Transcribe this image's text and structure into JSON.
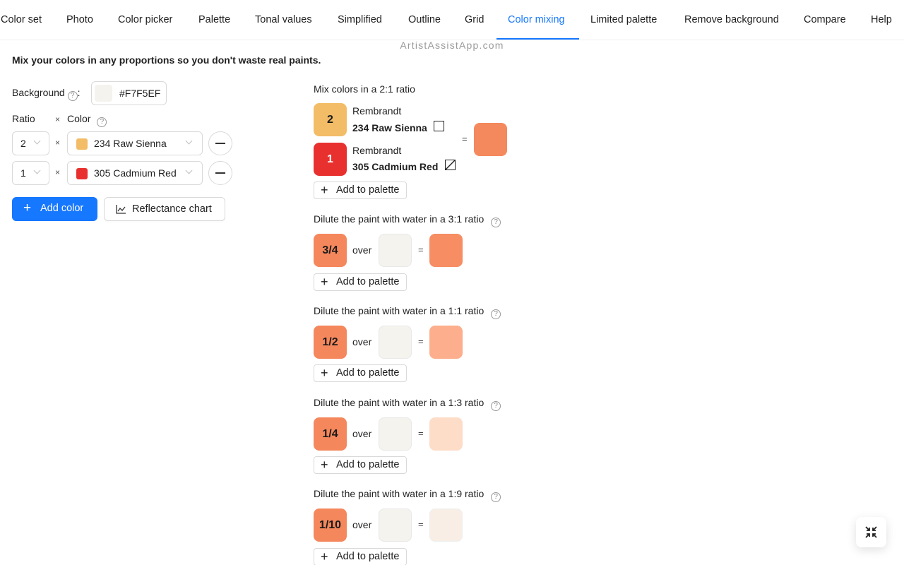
{
  "tabs": [
    {
      "label": "Color set",
      "active": false
    },
    {
      "label": "Photo",
      "active": false
    },
    {
      "label": "Color picker",
      "active": false
    },
    {
      "label": "Palette",
      "active": false
    },
    {
      "label": "Tonal values",
      "active": false
    },
    {
      "label": "Simplified",
      "active": false
    },
    {
      "label": "Outline",
      "active": false
    },
    {
      "label": "Grid",
      "active": false
    },
    {
      "label": "Color mixing",
      "active": true
    },
    {
      "label": "Limited palette",
      "active": false
    },
    {
      "label": "Remove background",
      "active": false
    },
    {
      "label": "Compare",
      "active": false
    },
    {
      "label": "Help",
      "active": false
    }
  ],
  "brand": "ArtistAssistApp.com",
  "intro": "Mix your colors in any proportions so you don't waste real paints.",
  "form": {
    "background_label": "Background",
    "background_colon": ":",
    "background_value": "#F7F5EF",
    "background_color": "#F4F3EE",
    "ratio_label": "Ratio",
    "times": "×",
    "color_label": "Color",
    "help_glyph": "?",
    "rows": [
      {
        "ratio": "2",
        "color_name": "234 Raw Sienna",
        "swatch": "#F2BD66"
      },
      {
        "ratio": "1",
        "color_name": "305 Cadmium Red",
        "swatch": "#E8312F"
      }
    ],
    "add_color_label": "Add color",
    "reflectance_label": "Reflectance chart"
  },
  "mix": {
    "title": "Mix colors in a 2:1 ratio",
    "equals": "=",
    "result_color": "#F5895E",
    "paints": [
      {
        "ratio": "2",
        "brand": "Rembrandt",
        "name": "234 Raw Sienna",
        "chip_color": "#F2BD66",
        "text_color": "#1a1a1a",
        "opacity_icon": "opaque-square-icon"
      },
      {
        "ratio": "1",
        "brand": "Rembrandt",
        "name": "305 Cadmium Red",
        "chip_color": "#E8312F",
        "text_color": "#ffffff",
        "opacity_icon": "semi-opaque-square-icon"
      }
    ],
    "add_to_palette": "Add to palette"
  },
  "dilutions": [
    {
      "title": "Dilute the paint with water in a 3:1 ratio",
      "fraction": "3/4",
      "over": "over",
      "paint_color": "#F5875C",
      "paper_color": "#F4F3EE",
      "result_color": "#F68D63",
      "add_to_palette": "Add to palette"
    },
    {
      "title": "Dilute the paint with water in a 1:1 ratio",
      "fraction": "1/2",
      "over": "over",
      "paint_color": "#F5875C",
      "paper_color": "#F4F3EE",
      "result_color": "#FDAE8C",
      "add_to_palette": "Add to palette"
    },
    {
      "title": "Dilute the paint with water in a 1:3 ratio",
      "fraction": "1/4",
      "over": "over",
      "paint_color": "#F5875C",
      "paper_color": "#F4F3EE",
      "result_color": "#FDDCC8",
      "add_to_palette": "Add to palette"
    },
    {
      "title": "Dilute the paint with water in a 1:9 ratio",
      "fraction": "1/10",
      "over": "over",
      "paint_color": "#F5875C",
      "paper_color": "#F4F3EE",
      "result_color": "#F8EEE5",
      "add_to_palette": "Add to palette"
    }
  ],
  "colors": {
    "accent": "#1677FF",
    "active_tab": "#1677FF"
  }
}
